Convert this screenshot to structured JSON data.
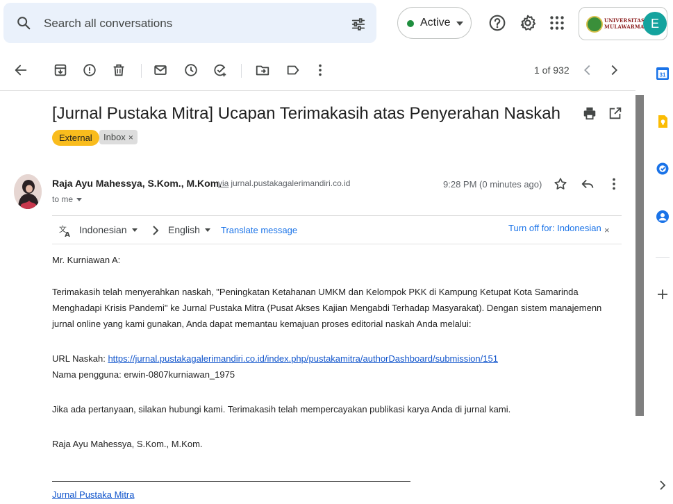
{
  "search": {
    "placeholder": "Search all conversations"
  },
  "status": {
    "label": "Active",
    "color": "#1e8e3e"
  },
  "org": {
    "logo_text_line1": "UNIVERSITAS",
    "logo_text_line2": "MULAWARMAN",
    "avatar_initial": "E"
  },
  "toolbar": {
    "pager": "1 of 932"
  },
  "email": {
    "subject": "[Jurnal Pustaka Mitra] Ucapan Terimakasih atas Penyerahan Naskah",
    "labels": {
      "external": "External",
      "inbox": "Inbox",
      "inbox_remove": "×"
    },
    "sender_name": "Raja Ayu Mahessya, S.Kom., M.Kom.",
    "via_word": "via",
    "via_domain": "jurnal.pustakagalerimandiri.co.id",
    "to": "to me",
    "time": "9:28 PM (0 minutes ago)"
  },
  "translate": {
    "source_lang": "Indonesian",
    "target_lang": "English",
    "translate_link": "Translate message",
    "turn_off": "Turn off for: Indonesian",
    "close": "×"
  },
  "body": {
    "greeting": "Mr. Kurniawan A:",
    "paragraph1": "Terimakasih telah menyerahkan naskah, \"Peningkatan Ketahanan UMKM dan Kelompok PKK di Kampung Ketupat Kota Samarinda Menghadapi Krisis Pandemi\" ke Jurnal Pustaka Mitra (Pusat Akses Kajian Mengabdi Terhadap Masyarakat). Dengan sistem manajemenn jurnal online yang kami gunakan, Anda dapat memantau kemajuan proses editorial naskah Anda melalui:",
    "url_label": "URL Naskah: ",
    "url": "https://jurnal.pustakagalerimandiri.co.id/index.php/pustakamitra/authorDashboard/submission/151",
    "username_line": "Nama pengguna: erwin-0807kurniawan_1975",
    "paragraph2": "Jika ada pertanyaan, silakan hubungi kami. Terimakasih telah mempercayakan publikasi karya Anda di jurnal kami.",
    "signature": "Raja Ayu Mahessya, S.Kom., M.Kom.",
    "journal_link": "Jurnal Pustaka Mitra"
  },
  "side_panel": {
    "calendar_day": "31"
  },
  "colors": {
    "external_label": "#f9bc1d",
    "link": "#1a73e8",
    "search_bg": "#eaf1fb",
    "avatar_bg": "#14a39e"
  }
}
